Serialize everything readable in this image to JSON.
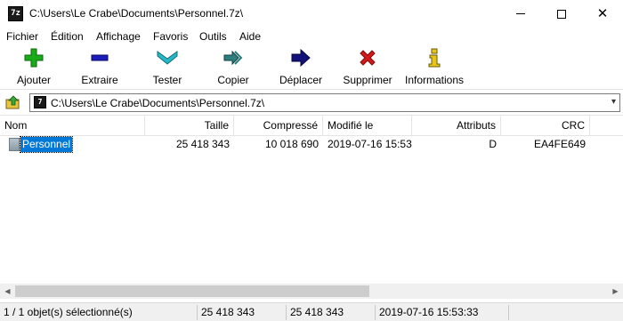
{
  "window": {
    "app_icon_text": "7z",
    "title": "C:\\Users\\Le Crabe\\Documents\\Personnel.7z\\",
    "minimize_icon": "minimize-icon",
    "maximize_icon": "maximize-icon",
    "close_icon": "close-icon"
  },
  "menu": [
    "Fichier",
    "Édition",
    "Affichage",
    "Favoris",
    "Outils",
    "Aide"
  ],
  "toolbar": {
    "add": {
      "label": "Ajouter",
      "icon": "plus-icon",
      "color": "#1aab1a"
    },
    "extract": {
      "label": "Extraire",
      "icon": "minus-icon",
      "color": "#1c1cb8"
    },
    "test": {
      "label": "Tester",
      "icon": "check-chevron-icon",
      "color": "#27b7c7"
    },
    "copy": {
      "label": "Copier",
      "icon": "double-arrow-icon",
      "color": "#2d7d7d"
    },
    "move": {
      "label": "Déplacer",
      "icon": "right-arrow-icon",
      "color": "#12127a"
    },
    "delete": {
      "label": "Supprimer",
      "icon": "x-icon",
      "color": "#d41a1a"
    },
    "info": {
      "label": "Informations",
      "icon": "info-icon",
      "color": "#e6c619"
    }
  },
  "address": {
    "path": "C:\\Users\\Le Crabe\\Documents\\Personnel.7z\\",
    "icon_text": "7"
  },
  "columns": [
    "Nom",
    "Taille",
    "Compressé",
    "Modifié le",
    "Attributs",
    "CRC"
  ],
  "rows": [
    {
      "name": "Personnel",
      "size": "25 418 343",
      "packed": "10 018 690",
      "modified": "2019-07-16 15:53",
      "attributes": "D",
      "crc": "EA4FE649",
      "selected": true
    }
  ],
  "status": {
    "selection": "1 / 1 objet(s) sélectionné(s)",
    "size": "25 418 343",
    "size2": "25 418 343",
    "date": "2019-07-16 15:53:33"
  }
}
